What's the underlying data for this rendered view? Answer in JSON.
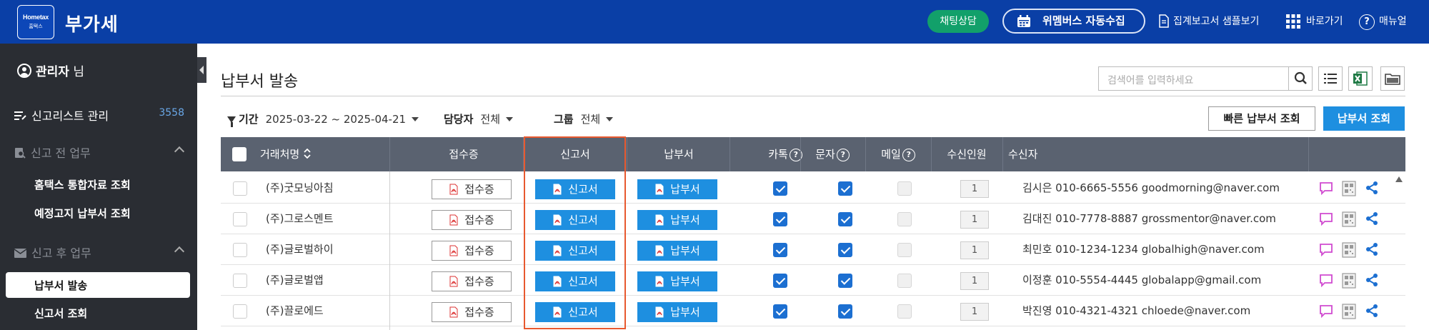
{
  "header": {
    "logo_top": "Hometax",
    "logo_bottom": "홈택스",
    "title": "부가세",
    "chat_label": "채팅상담",
    "wemembers_label": "위멤버스 자동수집",
    "report_sample_label": "집계보고서 샘플보기",
    "shortcut_label": "바로가기",
    "manual_label": "매뉴얼"
  },
  "sidebar": {
    "user_name": "관리자",
    "user_suffix": " 님",
    "list_manage_label": "신고리스트 관리",
    "list_manage_count": "3558",
    "section_before": "신고 전 업무",
    "item_hometax": "홈택스 통합자료 조회",
    "item_notice": "예정고지 납부서 조회",
    "section_after": "신고 후 업무",
    "item_send": "납부서 발송",
    "item_report": "신고서 조회"
  },
  "main": {
    "title": "납부서 발송",
    "search_placeholder": "검색어를 입력하세요",
    "filters": {
      "period_label": "기간",
      "period_value": "2025-03-22 ~ 2025-04-21",
      "manager_label": "담당자",
      "manager_value": "전체",
      "group_label": "그룹",
      "group_value": "전체"
    },
    "quick_query_label": "빠른 납부서 조회",
    "query_label": "납부서 조회"
  },
  "table": {
    "headers": {
      "company": "거래처명",
      "receipt": "접수증",
      "report": "신고서",
      "payment": "납부서",
      "kakao": "카톡",
      "sms": "문자",
      "mail": "메일",
      "recv_count": "수신인원",
      "recipient": "수신자"
    },
    "button_labels": {
      "receipt": "접수증",
      "report": "신고서",
      "payment": "납부서"
    },
    "rows": [
      {
        "company": "(주)굿모닝아침",
        "kakao": true,
        "sms": true,
        "mail": false,
        "count": "1",
        "recipient": "김시은 010-6665-5556 goodmorning@naver.com"
      },
      {
        "company": "(주)그로스멘트",
        "kakao": true,
        "sms": true,
        "mail": false,
        "count": "1",
        "recipient": "김대진 010-7778-8887 grossmentor@naver.com"
      },
      {
        "company": "(주)글로벌하이",
        "kakao": true,
        "sms": true,
        "mail": false,
        "count": "1",
        "recipient": "최민호 010-1234-1234 globalhigh@naver.com"
      },
      {
        "company": "(주)글로벌앱",
        "kakao": true,
        "sms": true,
        "mail": false,
        "count": "1",
        "recipient": "이정훈 010-5554-4445 globalapp@gmail.com"
      },
      {
        "company": "(주)끌로에드",
        "kakao": true,
        "sms": true,
        "mail": false,
        "count": "1",
        "recipient": "박진영 010-4321-4321 chloede@naver.com"
      }
    ]
  },
  "colors": {
    "header_bg": "#0a3fa6",
    "sidebar_bg": "#2a2d33",
    "accent_blue": "#1e8fe0",
    "highlight": "#e8592f",
    "chat_green": "#12a06a"
  }
}
